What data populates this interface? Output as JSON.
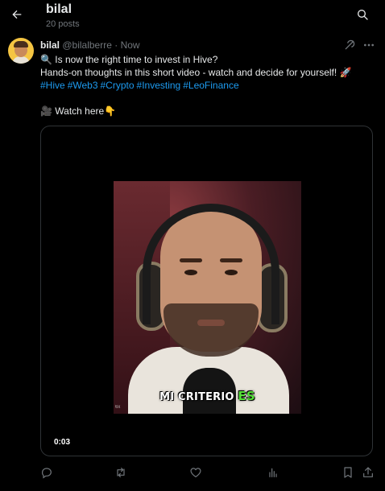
{
  "header": {
    "title": "bilal",
    "subtitle": "20 posts"
  },
  "post": {
    "author_name": "bilal",
    "handle": "@bilalberre",
    "separator": "·",
    "time": "Now",
    "line1": "🔍 Is now the right time to invest in Hive?",
    "line2": "Hands-on thoughts in this short video - watch and decide for yourself! 🚀",
    "hashtags": [
      "#Hive",
      "#Web3",
      "#Crypto",
      "#Investing",
      "#LeoFinance"
    ],
    "watch_line": "🎥 Watch here👇",
    "video": {
      "caption_main": "MI CRITERIO",
      "caption_highlight": "ES",
      "watermark": "6x",
      "timestamp": "0:03"
    }
  },
  "icons": {
    "back": "arrow-left-icon",
    "search": "search-icon",
    "grok": "grok-icon",
    "more": "more-icon",
    "reply": "reply-icon",
    "repost": "repost-icon",
    "like": "heart-icon",
    "views": "views-icon",
    "bookmark": "bookmark-icon",
    "share": "share-icon"
  },
  "colors": {
    "background": "#000000",
    "text": "#e7e9ea",
    "muted": "#71767b",
    "link": "#1d9bf0",
    "border": "#2f3336",
    "caption_highlight": "#56e13a"
  }
}
